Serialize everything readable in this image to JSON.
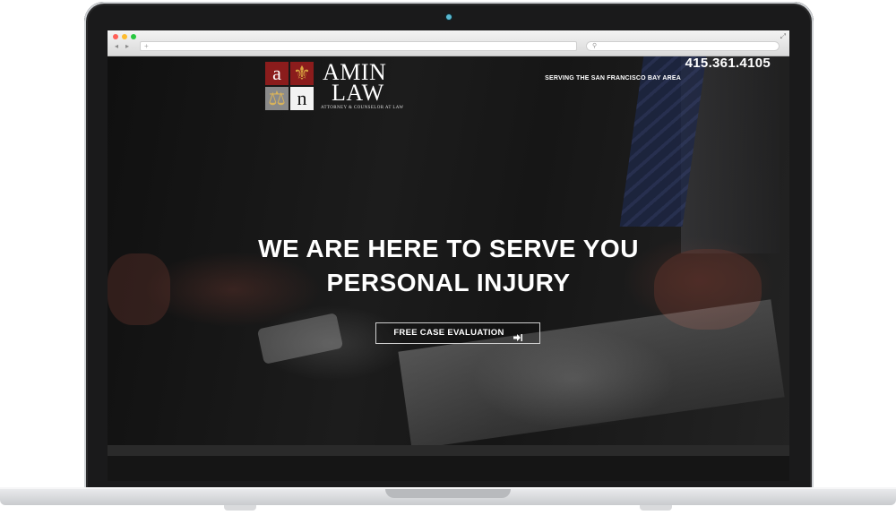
{
  "browser": {
    "back_glyph": "◂",
    "forward_glyph": "▸",
    "new_tab_glyph": "+",
    "search_glyph": "⚲",
    "fullscreen_glyph": "⤢"
  },
  "site": {
    "logo": {
      "tiles": [
        "a",
        "⚜",
        "⚖",
        "n"
      ],
      "name_line1": "AMIN",
      "name_line2": "LAW",
      "tagline": "ATTORNEY & COUNSELOR AT LAW"
    },
    "header": {
      "phone": "415.361.4105",
      "service_area": "SERVING THE SAN FRANCISCO BAY AREA"
    },
    "hero": {
      "line1": "WE ARE HERE TO SERVE YOU",
      "line2": "PERSONAL INJURY"
    },
    "cta": {
      "label": "FREE CASE EVALUATION",
      "icon": "sign-in-icon"
    }
  },
  "colors": {
    "logo_red": "#8b1c1c",
    "logo_gold": "#d9a441",
    "hero_text": "#ffffff",
    "camera": "#59b8d0"
  }
}
